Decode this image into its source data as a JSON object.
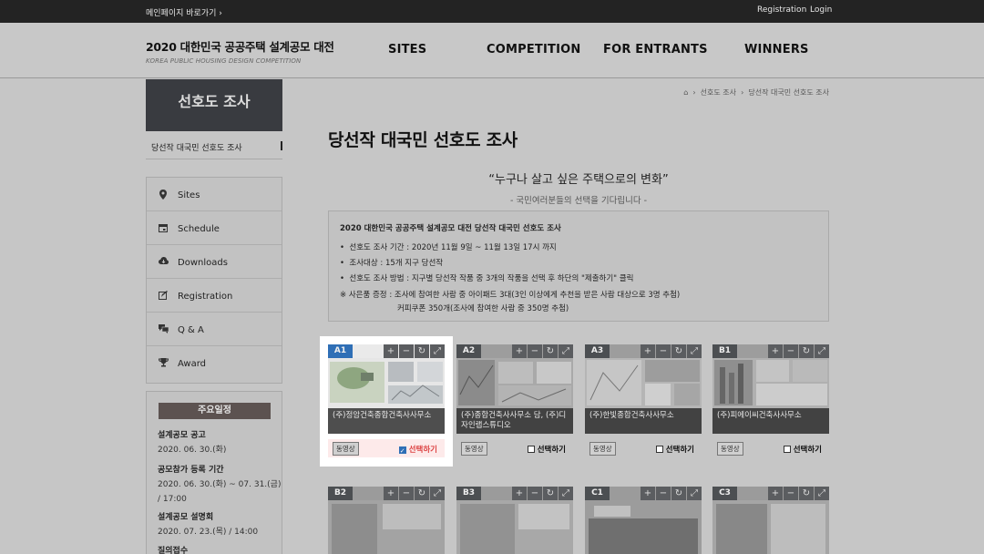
{
  "topbar": {
    "home_link": "메인페이지 바로가기 ›",
    "registration": "Registration",
    "separator": "·",
    "login": "Login"
  },
  "brand": {
    "title": "2020 대한민국 공공주택 설계공모 대전",
    "subtitle": "KOREA PUBLIC HOUSING DESIGN COMPETITION"
  },
  "nav": [
    "SITES",
    "COMPETITION",
    "FOR ENTRANTS",
    "WINNERS"
  ],
  "sidebar": {
    "title": "선호도 조사",
    "sub_item": "당선작 대국민 선호도 조사",
    "menu": [
      {
        "label": "Sites",
        "icon": "map-pin-icon"
      },
      {
        "label": "Schedule",
        "icon": "calendar-icon"
      },
      {
        "label": "Downloads",
        "icon": "cloud-download-icon"
      },
      {
        "label": "Registration",
        "icon": "edit-icon"
      },
      {
        "label": "Q & A",
        "icon": "chat-icon"
      },
      {
        "label": "Award",
        "icon": "trophy-icon"
      }
    ],
    "schedule_title": "주요일정",
    "schedule": [
      {
        "title": "설계공모 공고",
        "date": "2020. 06. 30.(화)"
      },
      {
        "title": "공모참가 등록 기간",
        "date": "2020. 06. 30.(화) ~ 07. 31.(금)",
        "time": "/ 17:00"
      },
      {
        "title": "설계공모 설명회",
        "date": "2020. 07. 23.(목) / 14:00"
      },
      {
        "title": "질의접수",
        "date": ""
      }
    ]
  },
  "breadcrumb": {
    "home": "⌂",
    "sep": "›",
    "level1": "선호도 조사",
    "level2": "당선작 대국민 선호도 조사"
  },
  "page_title": "당선작 대국민 선호도 조사",
  "quote": "“누구나 살고 싶은 주택으로의 변화”",
  "quote_sub": "- 국민여러분들의 선택을 기다립니다 -",
  "info": {
    "heading": "2020 대한민국 공공주택 설계공모 대전 당선작 대국민 선호도 조사",
    "items": [
      "선호도 조사 기간 : 2020년 11월 9일 ~ 11월 13일 17시 까지",
      "조사대상 : 15개 지구 당선작",
      "선호도 조사 방법 : 지구별 당선작 작품 중 3개의 작품을 선택 후 하단의 \"제출하기\" 클릭"
    ],
    "prize_line1": "※ 사은품 증정 : 조사에 참여한 사람 중 아이패드 3대(3인 이상에게 추천을 받은 사람 대상으로 3명 추첨)",
    "prize_line2": "커피쿠폰 350개(조사에 참여한 사람 중 350명 추첨)"
  },
  "cards": [
    {
      "code": "A1",
      "caption": "(주)정암건축종합건축사사무소",
      "video": "동영상",
      "select": "선택하기",
      "selected": true
    },
    {
      "code": "A2",
      "caption": "(주)종합건축사사무소 담, (주)디자인랩스튜디오",
      "video": "동영상",
      "select": "선택하기",
      "selected": false
    },
    {
      "code": "A3",
      "caption": "(주)한빛종합건축사사무소",
      "video": "동영상",
      "select": "선택하기",
      "selected": false
    },
    {
      "code": "B1",
      "caption": "(주)피에이씨건축사사무소",
      "video": "동영상",
      "select": "선택하기",
      "selected": false
    }
  ],
  "cards_row2": [
    "B2",
    "B3",
    "C1",
    "C3"
  ],
  "card_tools": [
    "+",
    "−",
    "↻",
    "⤢"
  ]
}
